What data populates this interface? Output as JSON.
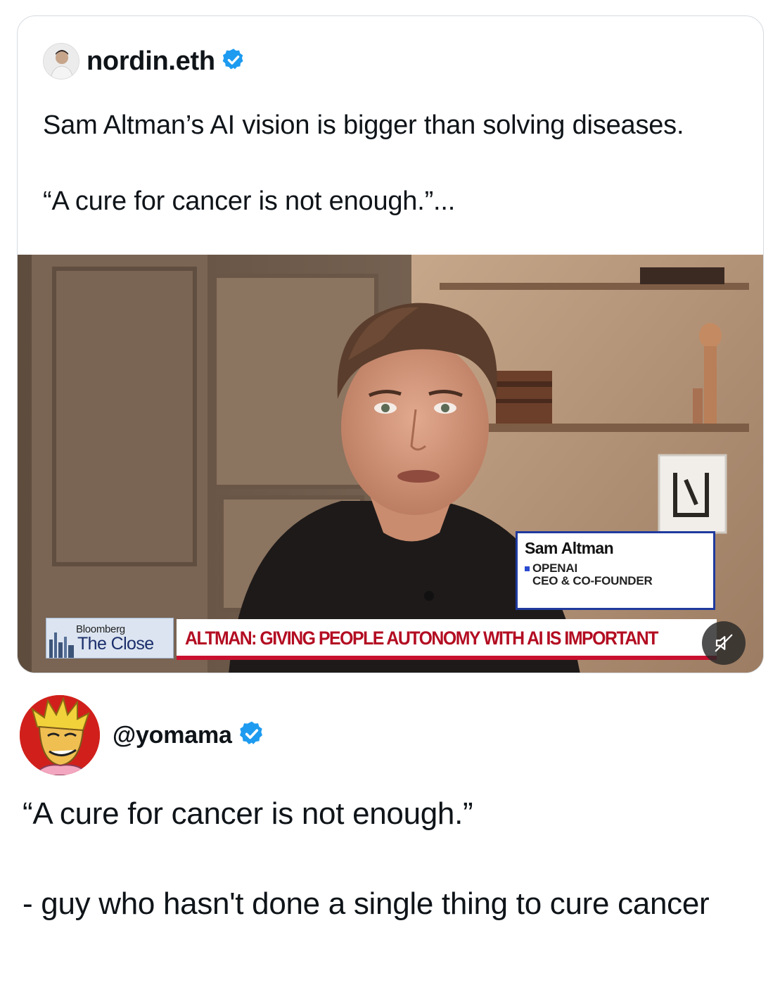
{
  "quoted_post": {
    "author": "nordin.eth",
    "verified_icon": "verified-badge-icon",
    "text": "Sam Altman’s AI vision is bigger than solving diseases.\n\n“A cure for cancer is not enough.”...",
    "video": {
      "lower_third": {
        "name": "Sam Altman",
        "org": "OPENAI",
        "role": "CEO & CO-FOUNDER"
      },
      "show_logo": {
        "brand": "Bloomberg",
        "show": "The Close"
      },
      "headline": "ALTMAN: GIVING PEOPLE AUTONOMY WITH AI IS IMPORTANT",
      "mute_icon": "speaker-muted-icon"
    }
  },
  "reply": {
    "handle": "@yomama",
    "verified_icon": "verified-badge-icon",
    "quote": "“A cure for cancer is not enough.”",
    "punchline": "- guy who hasn't done a single thing to cure cancer"
  },
  "colors": {
    "verified_blue": "#1d9bf0",
    "headline_red": "#c9102e",
    "lower_third_border": "#1f3a9e"
  }
}
